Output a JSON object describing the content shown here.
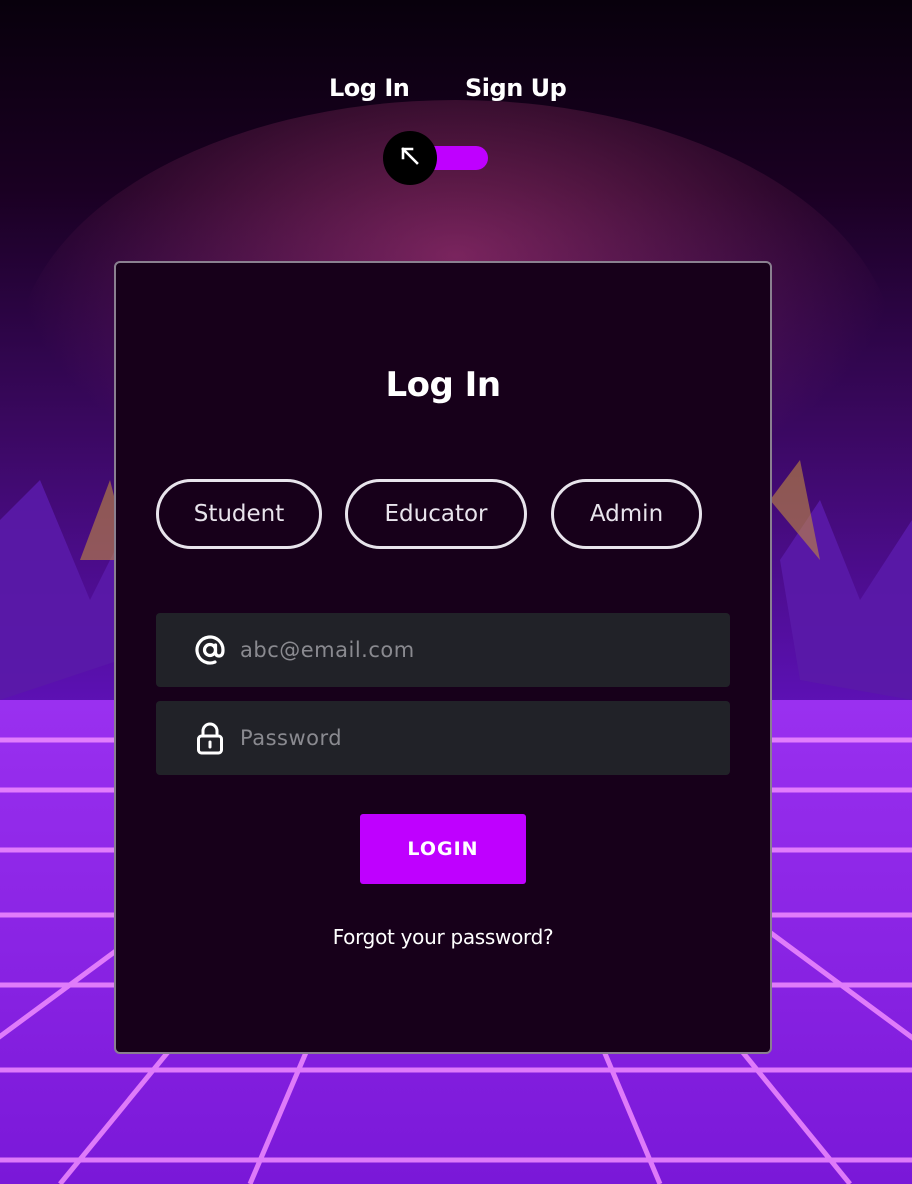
{
  "nav": {
    "login_tab": "Log In",
    "signup_tab": "Sign Up"
  },
  "toggle": {
    "icon": "arrow-up-left-icon",
    "state": "login",
    "accent": "#bf00ff"
  },
  "form": {
    "title": "Log In",
    "roles": [
      "Student",
      "Educator",
      "Admin"
    ],
    "email": {
      "icon": "at-sign-icon",
      "placeholder": "abc@email.com",
      "value": ""
    },
    "password": {
      "icon": "padlock-icon",
      "placeholder": "Password",
      "value": ""
    },
    "submit_label": "LOGIN",
    "forgot_link": "Forgot your password?"
  },
  "theme": {
    "accent": "#bf00ff",
    "card_background": "#17001a",
    "field_background": "#212228",
    "background_style": "synthwave purple neon grid"
  }
}
